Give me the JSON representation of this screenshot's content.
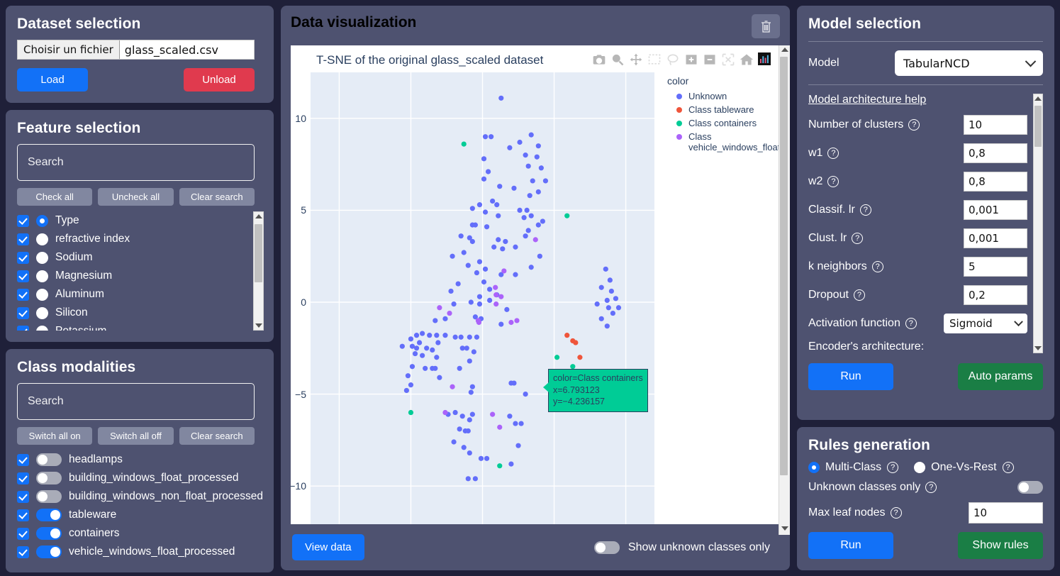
{
  "dataset": {
    "title": "Dataset selection",
    "file_button_label": "Choisir un fichier",
    "file_name": "glass_scaled.csv",
    "load_label": "Load",
    "unload_label": "Unload"
  },
  "features": {
    "title": "Feature selection",
    "search_placeholder": "Search",
    "buttons": {
      "check_all": "Check all",
      "uncheck_all": "Uncheck all",
      "clear_search": "Clear search"
    },
    "items": [
      {
        "label": "Type",
        "checked": true,
        "radio": true
      },
      {
        "label": "refractive index",
        "checked": true,
        "radio": false
      },
      {
        "label": "Sodium",
        "checked": true,
        "radio": false
      },
      {
        "label": "Magnesium",
        "checked": true,
        "radio": false
      },
      {
        "label": "Aluminum",
        "checked": true,
        "radio": false
      },
      {
        "label": "Silicon",
        "checked": true,
        "radio": false
      },
      {
        "label": "Potassium",
        "checked": true,
        "radio": false
      }
    ]
  },
  "modalities": {
    "title": "Class modalities",
    "search_placeholder": "Search",
    "buttons": {
      "switch_all_on": "Switch all on",
      "switch_all_off": "Switch all off",
      "clear_search": "Clear search"
    },
    "items": [
      {
        "label": "headlamps",
        "checked": true,
        "toggle": false
      },
      {
        "label": "building_windows_float_processed",
        "checked": true,
        "toggle": false
      },
      {
        "label": "building_windows_non_float_processed",
        "checked": true,
        "toggle": false
      },
      {
        "label": "tableware",
        "checked": true,
        "toggle": true
      },
      {
        "label": "containers",
        "checked": true,
        "toggle": true
      },
      {
        "label": "vehicle_windows_float_processed",
        "checked": true,
        "toggle": true
      }
    ]
  },
  "visualization": {
    "title": "Data visualization",
    "delete_icon": "trash-icon",
    "view_data_label": "View data",
    "show_unknown_label": "Show unknown classes only",
    "show_unknown_on": false,
    "modebar": [
      "camera-icon",
      "zoom-icon",
      "pan-icon",
      "box-select-icon",
      "lasso-icon",
      "zoom-in-icon",
      "zoom-out-icon",
      "autoscale-icon",
      "home-icon",
      "plotly-logo-icon"
    ],
    "tooltip": {
      "line1": "color=Class containers",
      "line2": "x=6.793123",
      "line3": "y=−4.236157"
    }
  },
  "chart_data": {
    "type": "scatter",
    "title": "T-SNE of the original glass_scaled dataset",
    "xlabel": "",
    "ylabel": "",
    "xlim": [
      -12,
      12
    ],
    "ylim": [
      -12.5,
      12.5
    ],
    "yticks": [
      10,
      5,
      0,
      -5,
      -10
    ],
    "ytick_labels": [
      "10",
      "5",
      "0",
      "−5",
      "−10"
    ],
    "grid": true,
    "legend_title": "color",
    "legend_position": "right",
    "series": [
      {
        "name": "Unknown",
        "color": "#636efa",
        "points": [
          [
            1.3,
            11.1
          ],
          [
            0.2,
            9.0
          ],
          [
            0.6,
            9.0
          ],
          [
            3.4,
            9.1
          ],
          [
            2.6,
            8.7
          ],
          [
            1.9,
            8.4
          ],
          [
            0.1,
            7.8
          ],
          [
            3.0,
            8.0
          ],
          [
            3.9,
            8.5
          ],
          [
            3.8,
            7.9
          ],
          [
            3.2,
            7.4
          ],
          [
            4.1,
            7.3
          ],
          [
            0.4,
            7.1
          ],
          [
            0.1,
            6.7
          ],
          [
            3.5,
            6.6
          ],
          [
            4.4,
            6.6
          ],
          [
            1.2,
            6.3
          ],
          [
            2.2,
            6.2
          ],
          [
            3.9,
            6.0
          ],
          [
            3.3,
            5.8
          ],
          [
            0.7,
            5.5
          ],
          [
            1.0,
            5.3
          ],
          [
            -0.2,
            5.3
          ],
          [
            -0.7,
            5.1
          ],
          [
            0.2,
            4.9
          ],
          [
            1.1,
            4.7
          ],
          [
            2.6,
            5.0
          ],
          [
            3.1,
            5.0
          ],
          [
            2.9,
            4.6
          ],
          [
            3.4,
            4.7
          ],
          [
            -0.7,
            4.2
          ],
          [
            -0.5,
            4.2
          ],
          [
            0.3,
            4.1
          ],
          [
            4.2,
            4.4
          ],
          [
            3.9,
            4.2
          ],
          [
            3.2,
            3.9
          ],
          [
            -1.5,
            3.6
          ],
          [
            -0.9,
            3.5
          ],
          [
            -0.7,
            3.3
          ],
          [
            1.1,
            3.4
          ],
          [
            1.6,
            3.3
          ],
          [
            3.0,
            3.6
          ],
          [
            0.8,
            3.0
          ],
          [
            1.4,
            2.9
          ],
          [
            2.3,
            3.0
          ],
          [
            -2.1,
            2.5
          ],
          [
            -1.3,
            2.7
          ],
          [
            4.0,
            2.5
          ],
          [
            -0.2,
            2.2
          ],
          [
            -1.0,
            2.0
          ],
          [
            0.2,
            1.8
          ],
          [
            -0.4,
            1.6
          ],
          [
            3.4,
            1.9
          ],
          [
            1.3,
            1.5
          ],
          [
            2.3,
            1.5
          ],
          [
            0.1,
            1.1
          ],
          [
            -1.7,
            1.0
          ],
          [
            0.5,
            0.7
          ],
          [
            -2.2,
            0.6
          ],
          [
            -0.2,
            0.3
          ],
          [
            1.0,
            0.4
          ],
          [
            -2.0,
            -0.1
          ],
          [
            -0.8,
            0.0
          ],
          [
            -0.2,
            -0.1
          ],
          [
            0.5,
            0.1
          ],
          [
            1.7,
            -0.4
          ],
          [
            -3.3,
            -1.0
          ],
          [
            -2.6,
            -0.9
          ],
          [
            -0.5,
            -0.8
          ],
          [
            -0.1,
            -0.9
          ],
          [
            1.3,
            -1.2
          ],
          [
            -4.6,
            -1.8
          ],
          [
            -4.2,
            -1.7
          ],
          [
            -3.7,
            -1.8
          ],
          [
            -3.2,
            -1.8
          ],
          [
            -2.6,
            -1.8
          ],
          [
            -1.9,
            -1.9
          ],
          [
            -1.5,
            -1.9
          ],
          [
            -0.9,
            -1.9
          ],
          [
            -0.4,
            -1.9
          ],
          [
            -5.0,
            -2.0
          ],
          [
            -4.4,
            -2.2
          ],
          [
            -3.1,
            -2.2
          ],
          [
            -5.6,
            -2.4
          ],
          [
            -4.9,
            -2.4
          ],
          [
            -4.6,
            -2.5
          ],
          [
            -3.9,
            -2.5
          ],
          [
            -3.5,
            -2.6
          ],
          [
            -1.4,
            -2.5
          ],
          [
            -1.1,
            -2.5
          ],
          [
            -0.6,
            -2.7
          ],
          [
            -4.7,
            -2.8
          ],
          [
            -4.2,
            -2.9
          ],
          [
            -3.2,
            -3.0
          ],
          [
            -0.9,
            -3.2
          ],
          [
            -4.9,
            -3.5
          ],
          [
            -4.0,
            -3.6
          ],
          [
            -3.5,
            -3.6
          ],
          [
            -3.3,
            -3.6
          ],
          [
            -1.6,
            -3.6
          ],
          [
            -5.2,
            -4.0
          ],
          [
            -3.0,
            -4.1
          ],
          [
            2.0,
            -4.4
          ],
          [
            2.2,
            -4.4
          ],
          [
            -5.0,
            -4.5
          ],
          [
            -5.3,
            -4.8
          ],
          [
            -0.7,
            -4.6
          ],
          [
            -0.8,
            -4.9
          ],
          [
            3.0,
            -5.0
          ],
          [
            -2.4,
            -6.1
          ],
          [
            -1.9,
            -6.0
          ],
          [
            -1.4,
            -6.2
          ],
          [
            -0.7,
            -6.1
          ],
          [
            -0.9,
            -6.4
          ],
          [
            1.9,
            -6.2
          ],
          [
            2.3,
            -6.6
          ],
          [
            2.7,
            -6.6
          ],
          [
            -1.6,
            -6.9
          ],
          [
            -1.2,
            -7.0
          ],
          [
            -1.0,
            -7.0
          ],
          [
            -2.0,
            -7.6
          ],
          [
            -1.3,
            -7.9
          ],
          [
            2.5,
            -7.8
          ],
          [
            -0.9,
            -8.2
          ],
          [
            -0.1,
            -8.5
          ],
          [
            0.3,
            -8.5
          ],
          [
            2.0,
            -8.8
          ],
          [
            -1.0,
            -9.6
          ],
          [
            -0.5,
            -9.6
          ],
          [
            8.6,
            1.8
          ],
          [
            8.9,
            1.2
          ],
          [
            8.3,
            0.8
          ],
          [
            9.0,
            0.6
          ],
          [
            8.7,
            0.1
          ],
          [
            9.3,
            0.2
          ],
          [
            8.0,
            -0.1
          ],
          [
            8.8,
            -0.3
          ],
          [
            9.5,
            -0.3
          ],
          [
            9.1,
            -0.6
          ],
          [
            8.3,
            -0.9
          ],
          [
            8.7,
            -1.3
          ],
          [
            7.1,
            -4.6
          ],
          [
            6.9,
            -5.0
          ]
        ]
      },
      {
        "name": "Class tableware",
        "color": "#ef553b",
        "points": [
          [
            5.9,
            -1.8
          ],
          [
            6.3,
            -2.1
          ],
          [
            6.5,
            -2.2
          ],
          [
            6.8,
            -3.0
          ],
          [
            7.2,
            -4.9
          ]
        ]
      },
      {
        "name": "Class containers",
        "color": "#00cc96",
        "points": [
          [
            -1.3,
            8.6
          ],
          [
            5.9,
            4.7
          ],
          [
            5.2,
            -3.0
          ],
          [
            6.3,
            -3.5
          ],
          [
            6.79,
            -4.24
          ],
          [
            6.5,
            -4.5
          ],
          [
            6.6,
            -4.95
          ],
          [
            6.6,
            -5.3
          ],
          [
            -5.0,
            -6.0
          ],
          [
            1.2,
            -8.9
          ]
        ]
      },
      {
        "name": "Class vehicle_windows_float_processed",
        "color": "#ab63fa",
        "points": [
          [
            3.7,
            3.4
          ],
          [
            1.5,
            1.7
          ],
          [
            0.9,
            0.8
          ],
          [
            0.95,
            0.4
          ],
          [
            0.95,
            -0.1
          ],
          [
            1.3,
            0.3
          ],
          [
            -3.0,
            -0.3
          ],
          [
            -2.3,
            -0.6
          ],
          [
            -0.3,
            -1.0
          ],
          [
            -0.25,
            -1.1
          ],
          [
            2.0,
            -1.1
          ],
          [
            2.4,
            -1.0
          ],
          [
            -2.1,
            -4.6
          ],
          [
            -2.6,
            -6.0
          ],
          [
            0.7,
            -6.1
          ],
          [
            1.2,
            -6.8
          ]
        ]
      }
    ]
  },
  "model": {
    "title": "Model selection",
    "model_label": "Model",
    "model_value": "TabularNCD",
    "help_link": "Model architecture help",
    "params": [
      {
        "label": "Number of clusters",
        "value": "10",
        "kind": "input"
      },
      {
        "label": "w1",
        "value": "0,8",
        "kind": "input"
      },
      {
        "label": "w2",
        "value": "0,8",
        "kind": "input"
      },
      {
        "label": "Classif. lr",
        "value": "0,001",
        "kind": "input"
      },
      {
        "label": "Clust. lr",
        "value": "0,001",
        "kind": "input"
      },
      {
        "label": "k neighbors",
        "value": "5",
        "kind": "input"
      },
      {
        "label": "Dropout",
        "value": "0,2",
        "kind": "input"
      },
      {
        "label": "Activation function",
        "value": "Sigmoid",
        "kind": "select"
      }
    ],
    "encoder_label": "Encoder's architecture:",
    "run_label": "Run",
    "auto_params_label": "Auto params"
  },
  "rules": {
    "title": "Rules generation",
    "multi_class_label": "Multi-Class",
    "one_vs_rest_label": "One-Vs-Rest",
    "mode": "multi",
    "unknown_only_label": "Unknown classes only",
    "unknown_only_on": false,
    "max_leaf_label": "Max leaf nodes",
    "max_leaf_value": "10",
    "run_label": "Run",
    "show_rules_label": "Show rules"
  },
  "colors": {
    "accent_blue": "#1271f7",
    "danger_red": "#e03a4e",
    "success_green": "#1a7e45",
    "panel": "#4e5270",
    "page_bg": "#1f2039"
  }
}
